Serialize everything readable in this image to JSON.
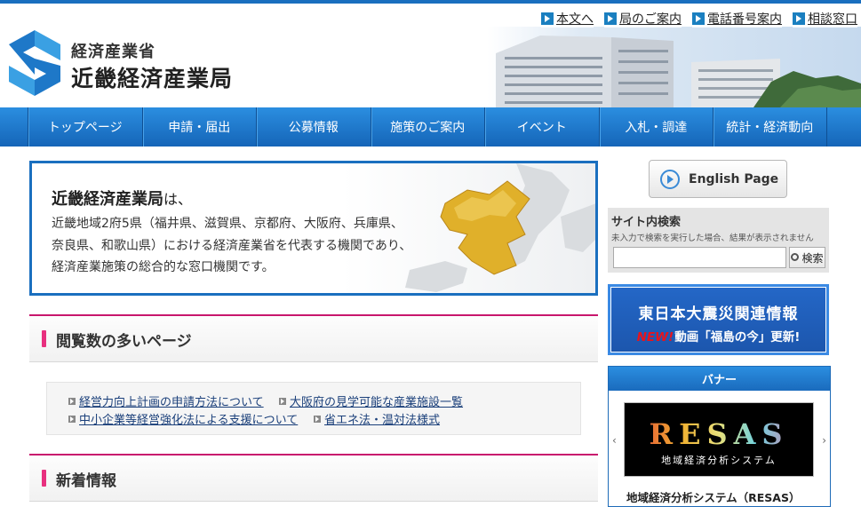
{
  "header": {
    "ministry": "経済産業省",
    "bureau": "近畿経済産業局"
  },
  "util_links": [
    "本文へ",
    "局のご案内",
    "電話番号案内",
    "相談窓口"
  ],
  "nav": [
    "トップページ",
    "申請・届出",
    "公募情報",
    "施策のご案内",
    "イベント",
    "入札・調達",
    "統計・経済動向"
  ],
  "intro": {
    "title": "近畿経済産業局",
    "title_suffix": "は、",
    "lines": [
      "近畿地域2府5県（福井県、滋賀県、京都府、大阪府、兵庫県、",
      "奈良県、和歌山県）における経済産業省を代表する機関であり、",
      "経済産業施策の総合的な窓口機関です。"
    ]
  },
  "popular": {
    "heading": "閲覧数の多いページ",
    "links": [
      "経営力向上計画の申請方法について",
      "大阪府の見学可能な産業施設一覧",
      "中小企業等経営強化法による支援について",
      "省エネ法・温対法様式"
    ]
  },
  "news": {
    "heading": "新着情報"
  },
  "english": {
    "label": "English Page"
  },
  "search": {
    "title": "サイト内検索",
    "note": "未入力で検索を実行した場合、結果が表示されません",
    "value": "",
    "button": "検索"
  },
  "quake": {
    "title": "東日本大震災関連情報",
    "new_label": "NEW!",
    "subtitle": "動画「福島の今」更新!"
  },
  "banner": {
    "heading": "バナー",
    "logo_word": "RESAS",
    "logo_sub": "地域経済分析システム",
    "caption": "地域経済分析システム（RESAS）",
    "prev": "‹",
    "next": "›"
  },
  "colors": {
    "nav_blue": "#1a6fbf",
    "accent_pink": "#e8307f",
    "quake_new": "#e8131b"
  }
}
